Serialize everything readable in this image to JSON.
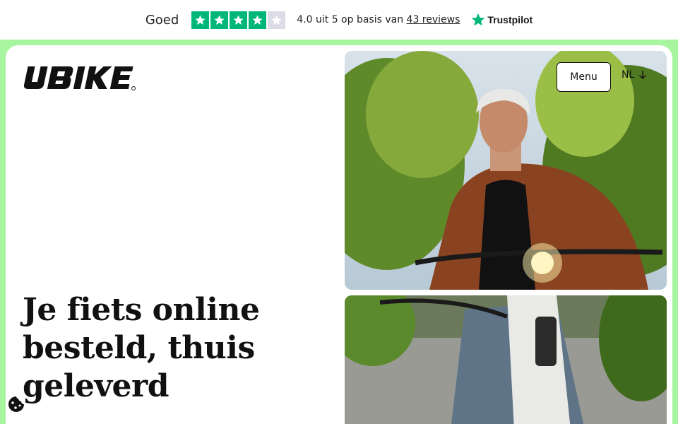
{
  "trustpilot": {
    "rating_word": "Goed",
    "rating_value": 4.0,
    "summary_prefix": "4.0 uit 5 op basis van",
    "reviews_link": "43 reviews",
    "brand": "Trustpilot",
    "star_color": "#00b67a"
  },
  "header": {
    "logo_text": "UBIKE",
    "menu_label": "Menu",
    "language": "NL",
    "language_icon": "arrow-down-icon"
  },
  "hero": {
    "title": "Je fiets online besteld, thuis geleverd"
  },
  "colors": {
    "background_accent": "#a8f5a0",
    "card": "#ffffff",
    "text": "#111111"
  },
  "cookie": {
    "icon": "cookie-icon"
  }
}
